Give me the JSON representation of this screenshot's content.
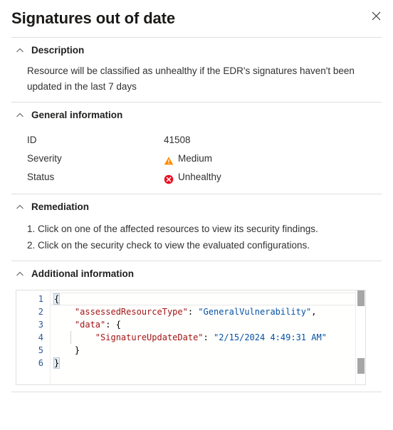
{
  "header": {
    "title": "Signatures out of date",
    "close_label": "Close"
  },
  "sections": {
    "description": {
      "title": "Description",
      "text": "Resource will be classified as unhealthy if the EDR's signatures haven't been updated in the last 7 days"
    },
    "general_information": {
      "title": "General information",
      "rows": [
        {
          "key": "ID",
          "value": "41508",
          "icon": ""
        },
        {
          "key": "Severity",
          "value": "Medium",
          "icon": "warning-triangle-icon"
        },
        {
          "key": "Status",
          "value": "Unhealthy",
          "icon": "error-circle-icon"
        }
      ]
    },
    "remediation": {
      "title": "Remediation",
      "steps": [
        "1. Click on one of the affected resources to view its security findings.",
        "2. Click on the security check to view the evaluated configurations."
      ]
    },
    "additional_information": {
      "title": "Additional information",
      "code": {
        "line_numbers": [
          "1",
          "2",
          "3",
          "4",
          "5",
          "6"
        ],
        "lines": [
          "{",
          "    \"assessedResourceType\": \"GeneralVulnerability\",",
          "    \"data\": {",
          "        \"SignatureUpdateDate\": \"2/15/2024 4:49:31 AM\"",
          "    }",
          "}"
        ],
        "raw": "{\n    \"assessedResourceType\": \"GeneralVulnerability\",\n    \"data\": {\n        \"SignatureUpdateDate\": \"2/15/2024 4:49:31 AM\"\n    }\n}",
        "tokens": {
          "l1_brace": "{",
          "l2_key": "\"assessedResourceType\"",
          "l2_colon": ": ",
          "l2_val": "\"GeneralVulnerability\"",
          "l2_comma": ",",
          "l3_key": "\"data\"",
          "l3_colon": ": ",
          "l3_brace": "{",
          "l4_key": "\"SignatureUpdateDate\"",
          "l4_colon": ": ",
          "l4_val": "\"2/15/2024 4:49:31 AM\"",
          "l5_brace": "}",
          "l6_brace": "}"
        }
      }
    }
  },
  "colors": {
    "severity_medium": "#ff8c00",
    "status_unhealthy": "#e81123",
    "json_key": "#a31515",
    "json_string": "#0451a5",
    "line_number": "#2b5797",
    "divider": "#e1dfdd"
  }
}
